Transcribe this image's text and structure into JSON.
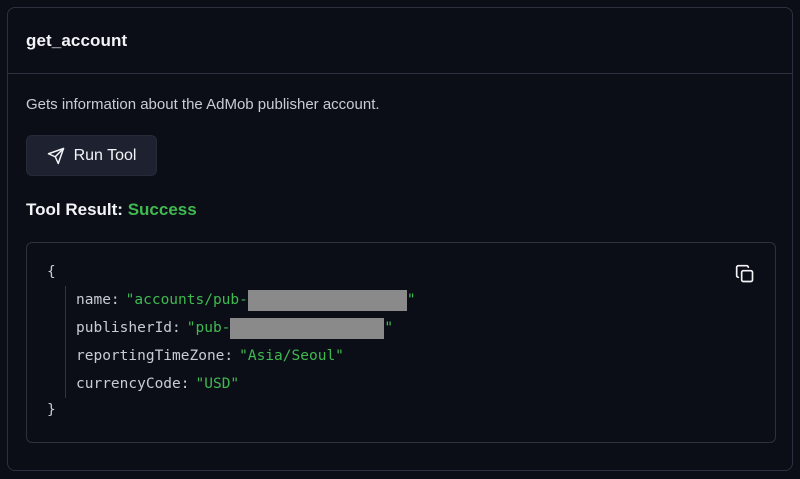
{
  "card": {
    "title": "get_account",
    "description": "Gets information about the AdMob publisher account."
  },
  "run_button": {
    "label": "Run Tool",
    "icon": "send-icon"
  },
  "result": {
    "label": "Tool Result:",
    "status": "Success",
    "status_color": "#3fb950"
  },
  "code": {
    "open_brace": "{",
    "close_brace": "}",
    "copy_icon": "copy-icon",
    "entries": [
      {
        "key": "name",
        "colon": ":",
        "value_prefix": "\"accounts/pub-",
        "redacted": true,
        "value_suffix": "\""
      },
      {
        "key": "publisherId",
        "colon": ":",
        "value_prefix": "\"pub-",
        "redacted": true,
        "value_suffix": "\""
      },
      {
        "key": "reportingTimeZone",
        "colon": ":",
        "value_prefix": "\"Asia/Seoul\"",
        "redacted": false,
        "value_suffix": ""
      },
      {
        "key": "currencyCode",
        "colon": ":",
        "value_prefix": "\"USD\"",
        "redacted": false,
        "value_suffix": ""
      }
    ]
  }
}
